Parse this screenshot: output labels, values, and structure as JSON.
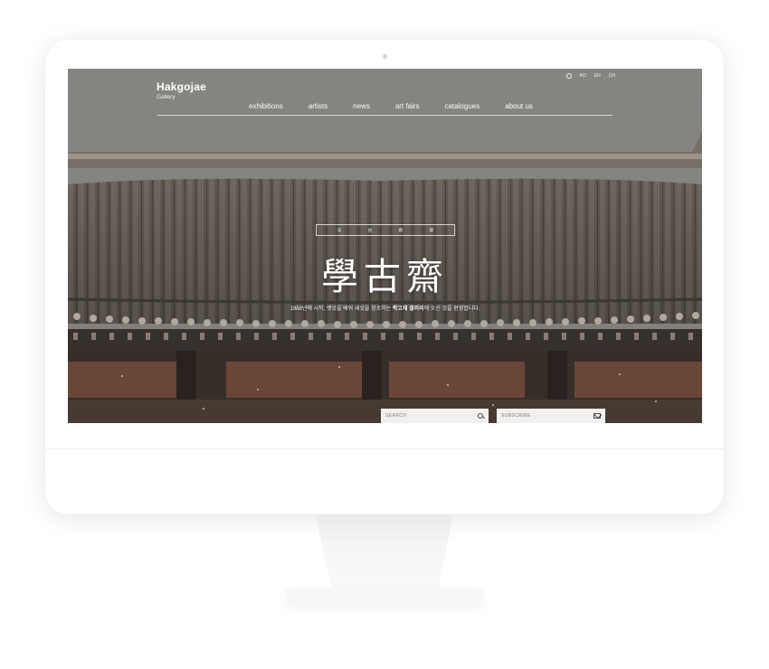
{
  "header": {
    "logo_title": "Hakgojae",
    "logo_subtitle": "Gallery",
    "languages": [
      "KO",
      "EN",
      "CH"
    ]
  },
  "nav": {
    "items": [
      "exhibitions",
      "artists",
      "news",
      "art fairs",
      "catalogues",
      "about us"
    ]
  },
  "hero": {
    "tagline_chars": [
      "法",
      "古",
      "創",
      "新"
    ],
    "title_hanja": "學古齋",
    "welcome_prefix": "1988년에 시작, 옛것을 배워 새것을 창조하는 ",
    "welcome_bold": "학고재 갤러리",
    "welcome_suffix": "에 오신 것을 환영합니다."
  },
  "search": {
    "placeholder": "SEARCH",
    "icon": "search-icon"
  },
  "subscribe": {
    "placeholder": "SUBSCRIBE",
    "icon": "mail-icon"
  },
  "colors": {
    "sky": "#8a8986",
    "roof": "#6b625a",
    "wall": "#6e4a3a",
    "field_bg": "#f1f0ee"
  }
}
